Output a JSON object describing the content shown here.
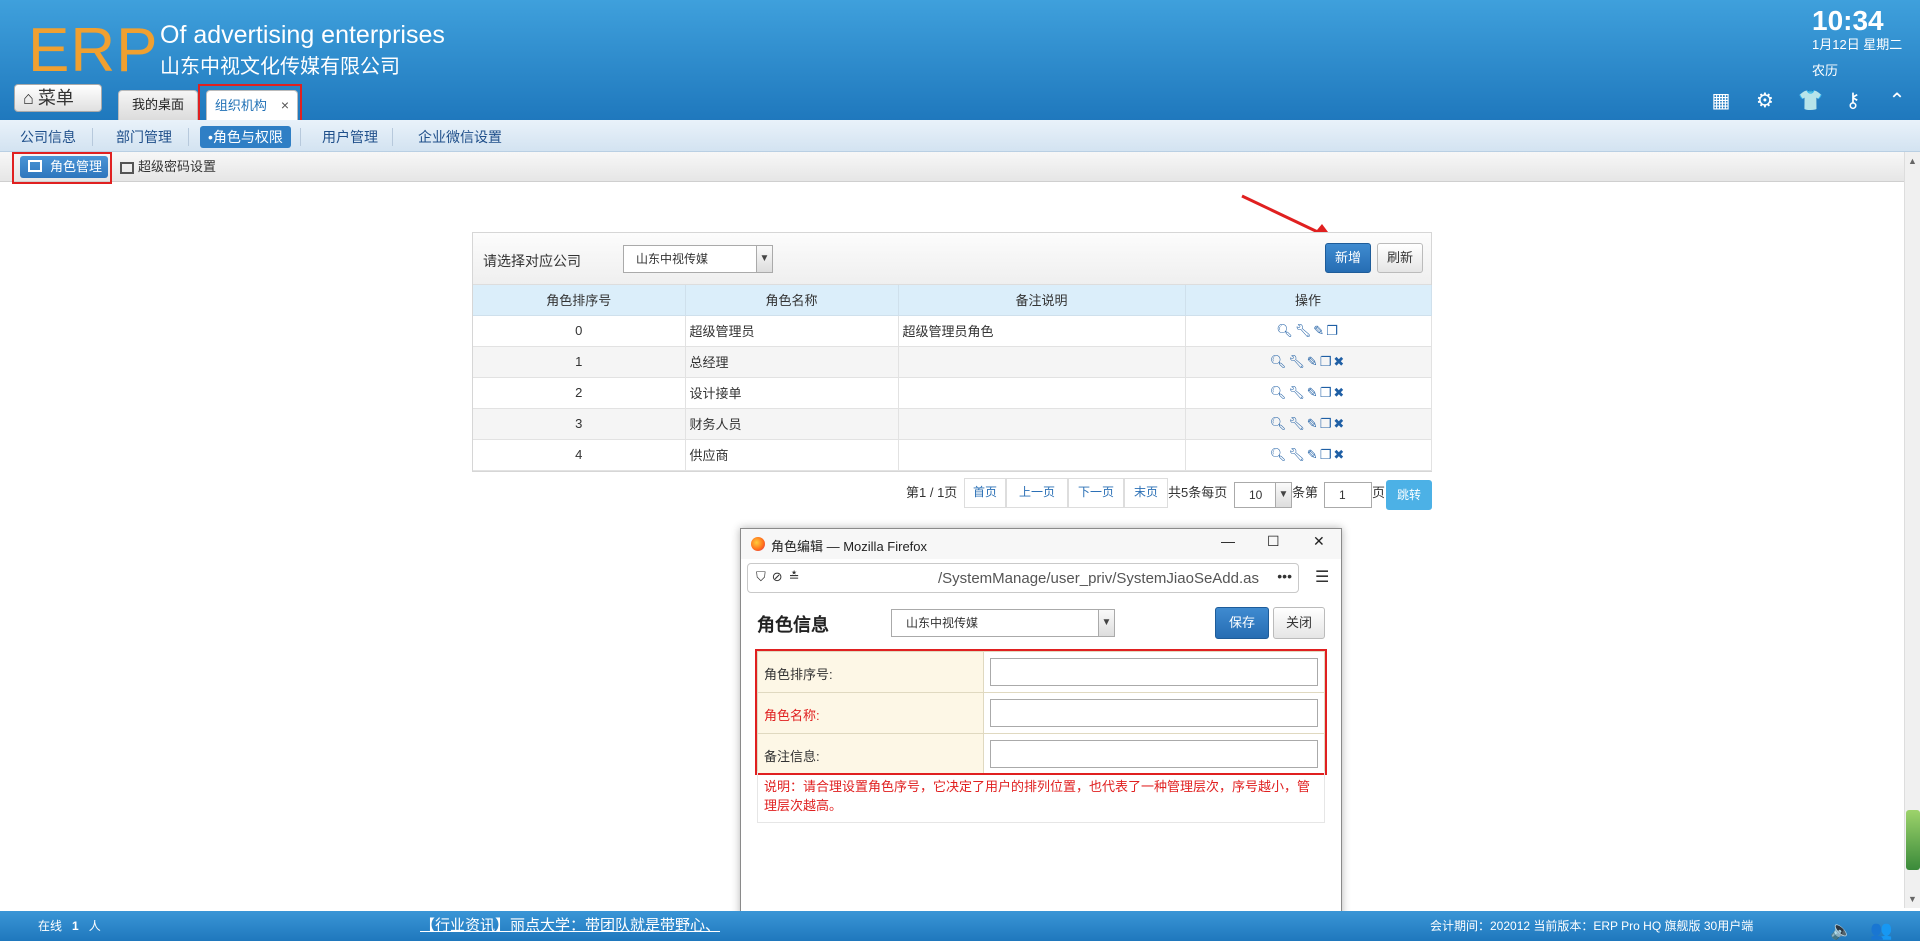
{
  "header": {
    "logo": "ERP",
    "slogan": "Of advertising enterprises",
    "company": "山东中视文化传媒有限公司",
    "time": "10:34",
    "date": "1月12日 星期二",
    "lunar": "农历",
    "icons": [
      "apps-icon",
      "gear-icon",
      "shirt-icon",
      "key-icon",
      "collapse-icon"
    ]
  },
  "menu_button": {
    "label": "菜单",
    "icon": "home-icon"
  },
  "tabs": [
    {
      "label": "我的桌面"
    },
    {
      "label": "组织机构",
      "close": "×"
    }
  ],
  "subnav": {
    "items": [
      "公司信息",
      "部门管理",
      "•角色与权限",
      "用户管理",
      "企业微信设置"
    ],
    "active": "•角色与权限"
  },
  "subsub": {
    "active": "角色管理",
    "other": "超级密码设置"
  },
  "panel": {
    "company_label": "请选择对应公司",
    "company_value": "山东中视传媒",
    "add_button": "新增",
    "refresh_button": "刷新",
    "columns": [
      "角色排序号",
      "角色名称",
      "备注说明",
      "操作"
    ],
    "rows": [
      {
        "order": "0",
        "name": "超级管理员",
        "note": "超级管理员角色",
        "deletable": false
      },
      {
        "order": "1",
        "name": "总经理",
        "note": "",
        "deletable": true
      },
      {
        "order": "2",
        "name": "设计接单",
        "note": "",
        "deletable": true
      },
      {
        "order": "3",
        "name": "财务人员",
        "note": "",
        "deletable": true
      },
      {
        "order": "4",
        "name": "供应商",
        "note": "",
        "deletable": true
      }
    ]
  },
  "pager": {
    "page_info": "第1 / 1页",
    "first": "首页",
    "prev": "上一页",
    "next": "下一页",
    "last": "末页",
    "total": "共5条每页",
    "per_page": "10",
    "unit": "条第",
    "page_input": "1",
    "page_suffix": "页",
    "jump": "跳转"
  },
  "popup": {
    "window_title": "角色编辑 — Mozilla Firefox",
    "url": "/SystemManage/user_priv/SystemJiaoSeAdd.as",
    "heading": "角色信息",
    "company_value": "山东中视传媒",
    "save": "保存",
    "close": "关闭",
    "fields": [
      {
        "label": "角色排序号:",
        "required": false
      },
      {
        "label": "角色名称:",
        "required": true
      },
      {
        "label": "备注信息:",
        "required": false
      }
    ],
    "note": "说明：请合理设置角色序号，它决定了用户的排列位置，也代表了一种管理层次，序号越小，管理层次越高。"
  },
  "footer": {
    "online_label": "在线",
    "online_count": "1",
    "online_unit": "人",
    "news": "【行业资讯】丽点大学：带团队就是带野心、",
    "account": "会计期间：202012 当前版本：ERP Pro HQ 旗舰版 30用户端"
  },
  "colors": {
    "header": "#1f78bd",
    "accent": "#2e76bd",
    "highlight": "#e02020"
  }
}
